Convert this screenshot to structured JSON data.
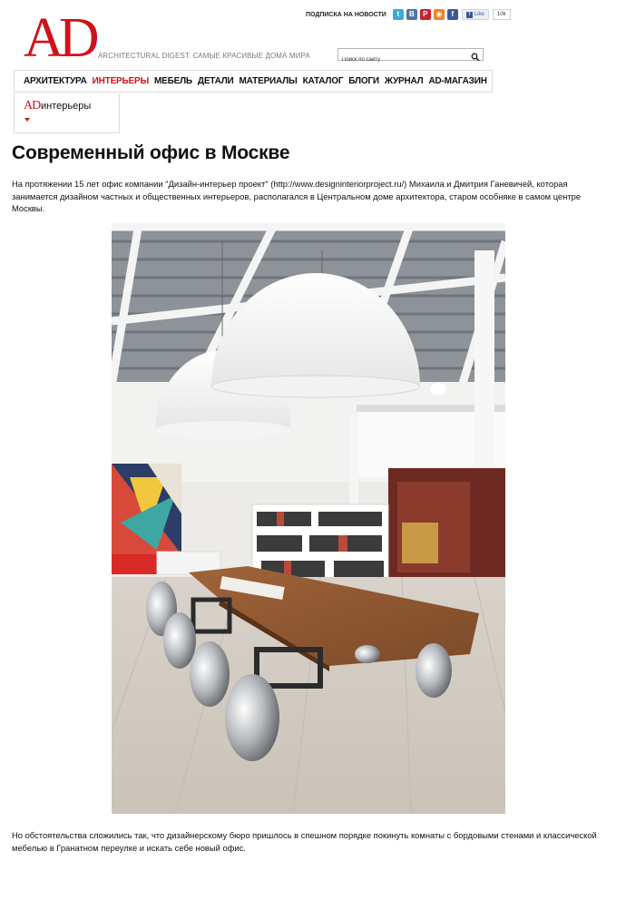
{
  "header": {
    "logo": "AD",
    "tagline": "ARCHITECTURAL DIGEST. САМЫЕ КРАСИВЫЕ ДОМА МИРА",
    "subscribe_label": "ПОДПИСКА НА НОВОСТИ",
    "social": [
      {
        "name": "twitter-icon",
        "glyph": "t",
        "color": "#3ea8e0"
      },
      {
        "name": "vk-icon",
        "glyph": "B",
        "color": "#4c75a3"
      },
      {
        "name": "pinterest-icon",
        "glyph": "P",
        "color": "#cb2027"
      },
      {
        "name": "rss-icon",
        "glyph": "◉",
        "color": "#f58220"
      },
      {
        "name": "facebook-icon",
        "glyph": "f",
        "color": "#3b5998"
      }
    ],
    "fb_like_label": "Like",
    "fb_like_count": "10k",
    "search_placeholder": "Поиск по сайту"
  },
  "nav": {
    "items": [
      {
        "label": "АРХИТЕКТУРА",
        "active": false
      },
      {
        "label": "ИНТЕРЬЕРЫ",
        "active": true
      },
      {
        "label": "МЕБЕЛЬ",
        "active": false
      },
      {
        "label": "ДЕТАЛИ",
        "active": false
      },
      {
        "label": "МАТЕРИАЛЫ",
        "active": false
      },
      {
        "label": "КАТАЛОГ",
        "active": false
      },
      {
        "label": "БЛОГИ",
        "active": false
      },
      {
        "label": "ЖУРНАЛ",
        "active": false
      },
      {
        "label": "AD-МАГАЗИН",
        "active": false
      }
    ]
  },
  "section": {
    "logo": "AD",
    "name": "интерьеры"
  },
  "article": {
    "title": "Современный офис в Москве",
    "intro": "На протяжении 15 лет офис компании \"Дизайн-интерьер проект\" (http://www.designinteriorproject.ru/) Михаила и Дмитрия Ганевичей, которая занимается дизайном частных и общественных интерьеров, располагался в Центральном доме архитектора, старом особняке в самом центре Москвы.",
    "outro": "Но обстоятельства сложились так, что дизайнерскому бюро пришлось в спешном порядке покинуть комнаты с бордовыми стенами и классической мебелью в Гранатном переулке и искать себе новый офис."
  },
  "colors": {
    "brand_red": "#d0121b",
    "text": "#111111",
    "muted": "#7a7a7a",
    "border": "#dcdcdc"
  }
}
